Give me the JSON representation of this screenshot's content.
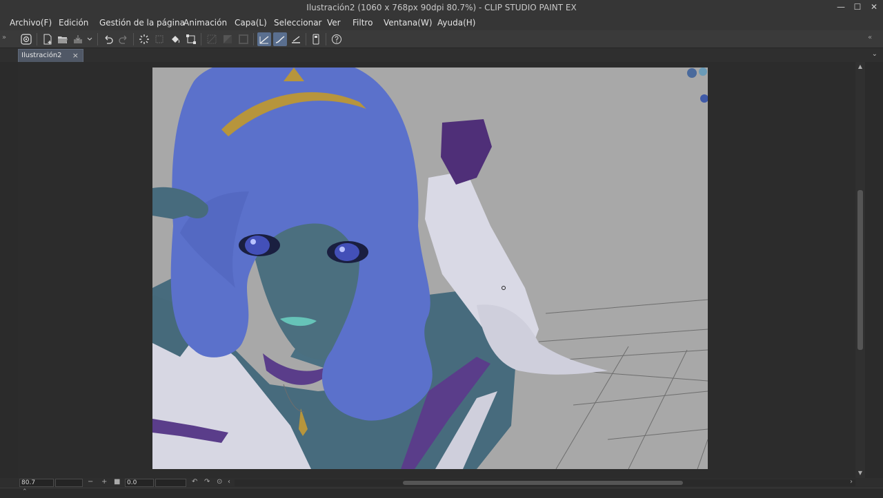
{
  "window": {
    "title": "Ilustración2 (1060 x 768px 90dpi 80.7%)  - CLIP STUDIO PAINT EX",
    "controls": {
      "minimize": "—",
      "maximize": "☐",
      "close": "✕"
    }
  },
  "menu": {
    "items": [
      {
        "label": "Archivo(F)"
      },
      {
        "label": "Edición"
      },
      {
        "label": "Gestión de la página"
      },
      {
        "label": "Animación"
      },
      {
        "label": "Capa(L)"
      },
      {
        "label": "Seleccionar"
      },
      {
        "label": "Ver"
      },
      {
        "label": "Filtro"
      },
      {
        "label": "Ventana(W)"
      },
      {
        "label": "Ayuda(H)"
      }
    ]
  },
  "toolbar": {
    "icons": [
      "clip-studio-icon",
      "new-file-icon",
      "open-file-icon",
      "save-icon",
      "undo-icon",
      "redo-icon",
      "loading-icon",
      "clear-icon",
      "fill-icon",
      "transform-icon",
      "deselect-icon",
      "invert-selection-icon",
      "selection-border-icon",
      "correction-line-1-icon",
      "correction-line-2-icon",
      "correction-line-3-icon",
      "device-icon",
      "help-icon"
    ],
    "active_color": "#5a6f8f"
  },
  "tabs": {
    "document": "Ilustración2",
    "close": "×",
    "dropdown": "⌄"
  },
  "status": {
    "zoom": "80.7",
    "rotation": "0.0"
  },
  "colors": {
    "background": "#2b2b2b",
    "canvas_bg": "#a7a7a7",
    "hair": "#5b70c9",
    "skin": "#45697a",
    "glove": "#d8d8e4",
    "accent_purple": "#5a3d8a"
  }
}
